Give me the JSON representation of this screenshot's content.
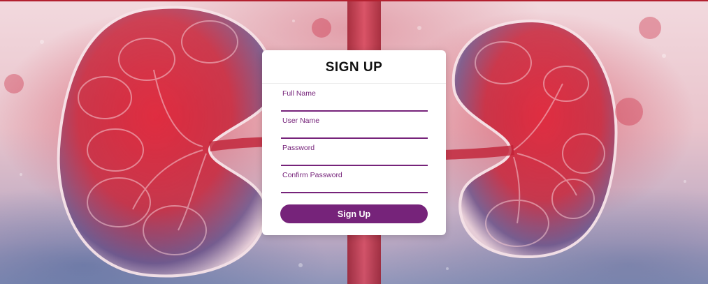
{
  "form": {
    "title": "SIGN UP",
    "fields": [
      {
        "label": "Full Name",
        "value": ""
      },
      {
        "label": "User Name",
        "value": ""
      },
      {
        "label": "Password",
        "value": ""
      },
      {
        "label": "Confirm Password",
        "value": ""
      }
    ],
    "submit_label": "Sign Up"
  },
  "colors": {
    "accent": "#76237a",
    "card": "#ffffff",
    "background_red": "#d2233a",
    "background_blue": "#7d8fbf"
  },
  "background": {
    "image": "kidney-illustration"
  }
}
